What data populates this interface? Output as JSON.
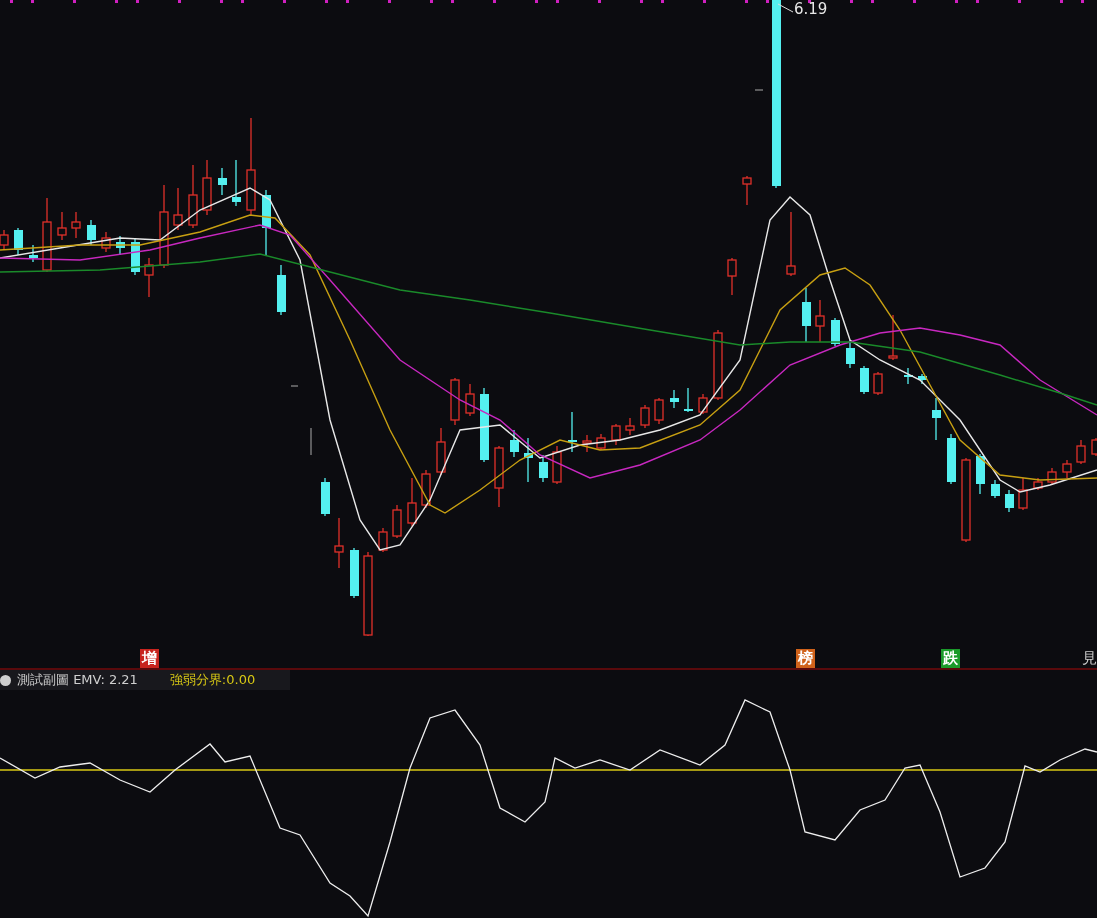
{
  "main_chart": {
    "high_label": "6.19",
    "markers": [
      {
        "text": "增",
        "color": "#c8241e"
      },
      {
        "text": "榜",
        "color": "#d0621a"
      },
      {
        "text": "跌",
        "color": "#1a9a2a"
      },
      {
        "text": "見"
      }
    ]
  },
  "sub_chart": {
    "title": "測試副圖",
    "indicator": "EMV: 2.21",
    "threshold": "強弱分界:0.00"
  }
}
